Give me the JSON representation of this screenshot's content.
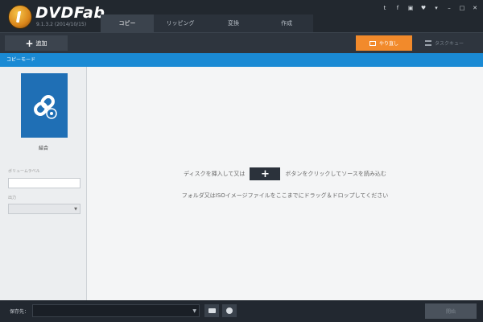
{
  "app": {
    "brand": "DVDFab",
    "version": "9.1.3.2 (2014/10/15)"
  },
  "tabs": [
    {
      "label": "コピー",
      "active": true
    },
    {
      "label": "リッピング",
      "active": false
    },
    {
      "label": "変換",
      "active": false
    },
    {
      "label": "作成",
      "active": false
    }
  ],
  "window_controls": [
    "twitter-icon",
    "facebook-icon",
    "youtube-icon",
    "heart-icon",
    "menu-icon",
    "minimize-icon",
    "restore-icon",
    "close-icon"
  ],
  "toolbar": {
    "add_label": "追加",
    "makeover_label": "やり直し",
    "queue_label": "タスクキュー"
  },
  "modebar": {
    "label": "コピーモード"
  },
  "left_panel": {
    "mode_name": "結合",
    "volume_label_caption": "ボリュームラベル",
    "volume_label_value": "",
    "output_caption": "出力",
    "output_value": ""
  },
  "main": {
    "line1_before": "ディスクを挿入して又は",
    "line1_after": "ボタンをクリックしてソースを読み込む",
    "line2": "フォルダ又はISOイメージファイルをここまでにドラッグ＆ドロップしてください"
  },
  "bottom": {
    "save_to_label": "保存先：",
    "save_path_value": "",
    "start_label": "開始"
  },
  "colors": {
    "accent_blue": "#1a8ad4",
    "accent_orange": "#f28a2b",
    "mode_card": "#1f6fb5"
  }
}
